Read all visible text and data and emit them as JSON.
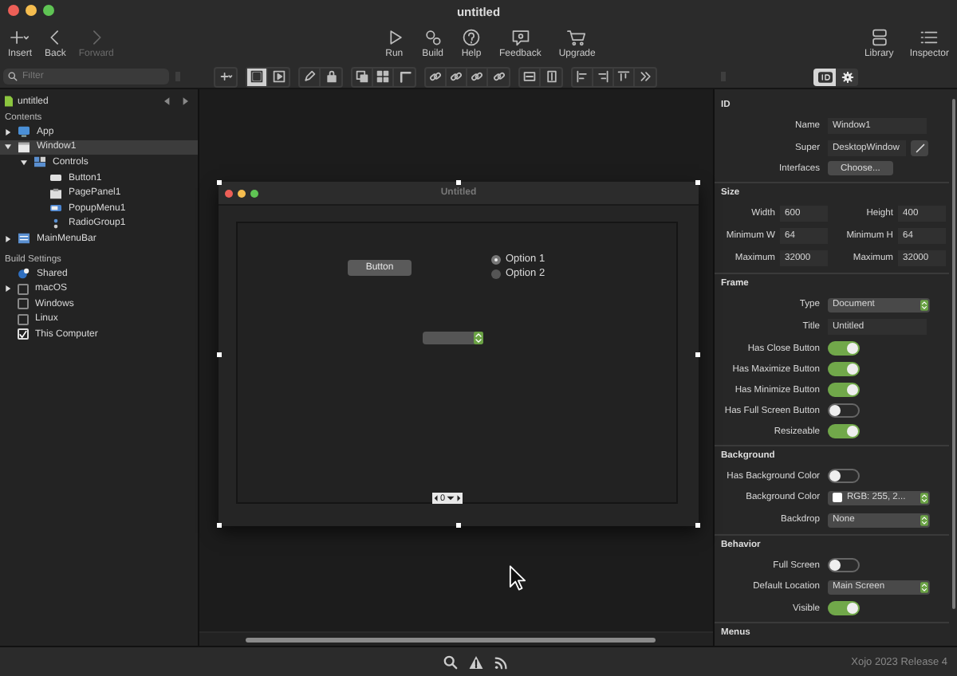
{
  "window": {
    "title": "untitled"
  },
  "toolbar": {
    "left": [
      {
        "label": "Insert",
        "kind": "insert",
        "disabled": false
      },
      {
        "label": "Back",
        "kind": "back",
        "disabled": false
      },
      {
        "label": "Forward",
        "kind": "forward",
        "disabled": true
      }
    ],
    "center": [
      {
        "label": "Run",
        "kind": "run",
        "disabled": false
      },
      {
        "label": "Build",
        "kind": "build",
        "disabled": false
      },
      {
        "label": "Help",
        "kind": "help",
        "disabled": false
      },
      {
        "label": "Feedback",
        "kind": "feedback",
        "disabled": false
      },
      {
        "label": "Upgrade",
        "kind": "upgrade",
        "disabled": false
      }
    ],
    "right": [
      {
        "label": "Library",
        "kind": "library",
        "disabled": false
      },
      {
        "label": "Inspector",
        "kind": "inspector",
        "disabled": false
      }
    ]
  },
  "navigator": {
    "filter": {
      "placeholder": "Filter"
    },
    "project": "untitled",
    "contents": {
      "title": "Contents",
      "items": [
        {
          "label": "App",
          "kind": "app",
          "expanded": false,
          "selected": false
        },
        {
          "label": "Window1",
          "kind": "window",
          "expanded": true,
          "selected": true,
          "children": [
            {
              "label": "Controls",
              "kind": "controls",
              "expanded": true,
              "selected": false,
              "children": [
                {
                  "label": "Button1",
                  "kind": "button",
                  "selected": false
                },
                {
                  "label": "PagePanel1",
                  "kind": "pagepanel",
                  "selected": false
                },
                {
                  "label": "PopupMenu1",
                  "kind": "popup",
                  "selected": false
                },
                {
                  "label": "RadioGroup1",
                  "kind": "radio",
                  "selected": false
                }
              ]
            }
          ]
        },
        {
          "label": "MainMenuBar",
          "kind": "menubar",
          "expanded": false,
          "selected": false
        }
      ]
    },
    "build_settings": {
      "title": "Build Settings",
      "items": [
        {
          "label": "Shared",
          "kind": "shared"
        },
        {
          "label": "macOS",
          "kind": "checkbox",
          "checked": false,
          "expanded": false
        },
        {
          "label": "Windows",
          "kind": "checkbox",
          "checked": false
        },
        {
          "label": "Linux",
          "kind": "checkbox",
          "checked": false
        },
        {
          "label": "This Computer",
          "kind": "checkbox",
          "checked": true
        }
      ]
    }
  },
  "editor": {
    "view_modes": [
      {
        "kind": "layout",
        "selected": true
      },
      {
        "kind": "preview",
        "selected": false
      }
    ],
    "design_window": {
      "title": "Untitled",
      "controls": [
        {
          "kind": "button",
          "label": "Button"
        },
        {
          "kind": "radio_group",
          "options": [
            {
              "label": "Option 1",
              "selected": true
            },
            {
              "label": "Option 2",
              "selected": false
            }
          ]
        },
        {
          "kind": "popup_menu"
        },
        {
          "kind": "page_panel",
          "page": "0"
        }
      ]
    }
  },
  "inspector": {
    "tabs": [
      {
        "kind": "id",
        "selected": true
      },
      {
        "kind": "gear",
        "selected": false
      }
    ],
    "sections": [
      {
        "title": "ID",
        "rows": [
          {
            "kind": "text",
            "label": "Name",
            "value": "Window1"
          },
          {
            "kind": "text_edit",
            "label": "Super",
            "value": "DesktopWindow"
          },
          {
            "kind": "button",
            "label": "Interfaces",
            "value": "Choose..."
          }
        ]
      },
      {
        "title": "Size",
        "rows": [
          {
            "kind": "pair",
            "fields": [
              {
                "label": "Width",
                "value": "600"
              },
              {
                "label": "Height",
                "value": "400"
              }
            ]
          },
          {
            "kind": "pair",
            "fields": [
              {
                "label": "Minimum W",
                "value": "64"
              },
              {
                "label": "Minimum H",
                "value": "64"
              }
            ]
          },
          {
            "kind": "pair",
            "fields": [
              {
                "label": "Maximum",
                "value": "32000"
              },
              {
                "label": "Maximum",
                "value": "32000"
              }
            ]
          }
        ]
      },
      {
        "title": "Frame",
        "rows": [
          {
            "kind": "popup",
            "label": "Type",
            "value": "Document"
          },
          {
            "kind": "text",
            "label": "Title",
            "value": "Untitled"
          },
          {
            "kind": "switch",
            "label": "Has Close Button",
            "on": true
          },
          {
            "kind": "switch",
            "label": "Has Maximize Button",
            "on": true
          },
          {
            "kind": "switch",
            "label": "Has Minimize Button",
            "on": true
          },
          {
            "kind": "switch",
            "label": "Has Full Screen Button",
            "on": false
          },
          {
            "kind": "switch",
            "label": "Resizeable",
            "on": true
          }
        ]
      },
      {
        "title": "Background",
        "rows": [
          {
            "kind": "switch",
            "label": "Has Background Color",
            "on": false
          },
          {
            "kind": "color",
            "label": "Background Color",
            "value": "RGB: 255, 2...",
            "color": "#ffffff"
          },
          {
            "kind": "popup",
            "label": "Backdrop",
            "value": "None"
          }
        ]
      },
      {
        "title": "Behavior",
        "rows": [
          {
            "kind": "switch",
            "label": "Full Screen",
            "on": false
          },
          {
            "kind": "popup",
            "label": "Default Location",
            "value": "Main Screen"
          },
          {
            "kind": "switch",
            "label": "Visible",
            "on": true
          }
        ]
      },
      {
        "title": "Menus"
      }
    ]
  },
  "status_bar": {
    "version": "Xojo 2023 Release 4"
  }
}
